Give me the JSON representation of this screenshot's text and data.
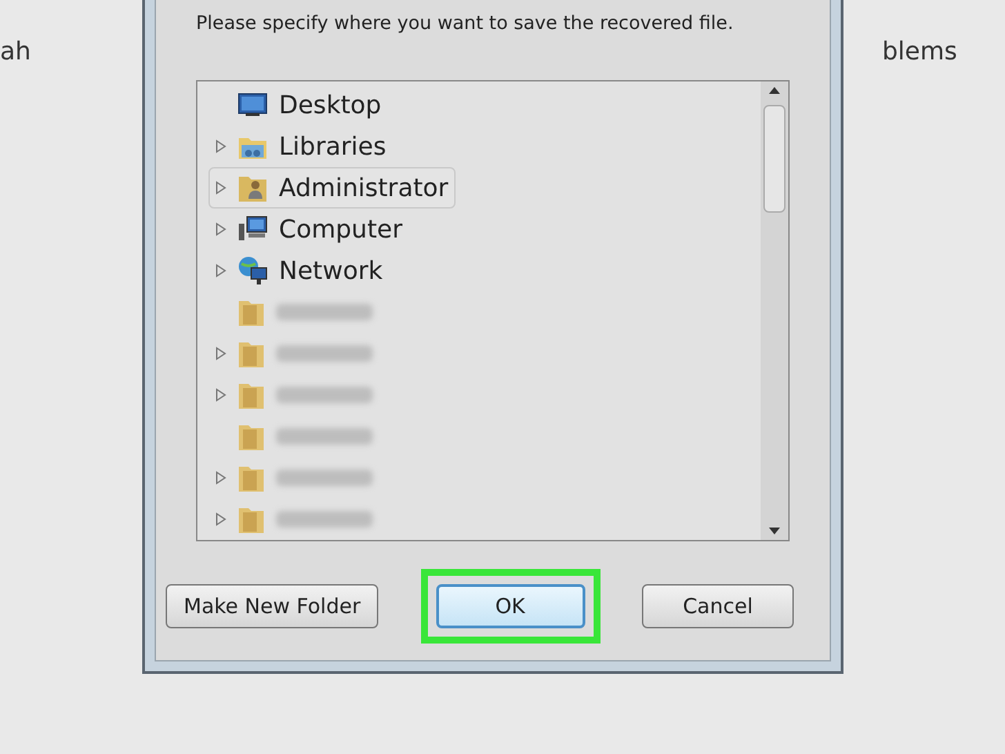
{
  "background": {
    "left_text": "ah",
    "right_text": "blems"
  },
  "dialog": {
    "message": "Please specify where you want to save the recovered file.",
    "tree": [
      {
        "kind": "desktop",
        "label": "Desktop",
        "expandable": false,
        "selected": false
      },
      {
        "kind": "libraries",
        "label": "Libraries",
        "expandable": true,
        "selected": false
      },
      {
        "kind": "user",
        "label": "Administrator",
        "expandable": true,
        "selected": true
      },
      {
        "kind": "computer",
        "label": "Computer",
        "expandable": true,
        "selected": false
      },
      {
        "kind": "network",
        "label": "Network",
        "expandable": true,
        "selected": false
      },
      {
        "kind": "blurred",
        "expandable": false,
        "selected": false
      },
      {
        "kind": "blurred",
        "expandable": true,
        "selected": false
      },
      {
        "kind": "blurred",
        "expandable": true,
        "selected": false
      },
      {
        "kind": "blurred",
        "expandable": false,
        "selected": false
      },
      {
        "kind": "blurred",
        "expandable": true,
        "selected": false
      },
      {
        "kind": "blurred",
        "expandable": true,
        "selected": false
      }
    ],
    "buttons": [
      {
        "label": "Make New Folder",
        "default": false,
        "highlighted": false
      },
      {
        "label": "OK",
        "default": true,
        "highlighted": true
      },
      {
        "label": "Cancel",
        "default": false,
        "highlighted": false
      }
    ]
  }
}
